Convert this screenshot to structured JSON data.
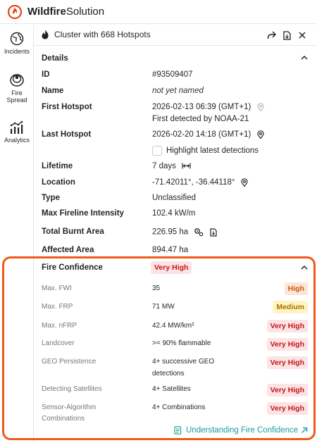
{
  "app": {
    "brand_bold": "Wildfire",
    "brand_light": "Solution"
  },
  "rail": {
    "incidents": "Incidents",
    "fire_spread_1": "Fire",
    "fire_spread_2": "Spread",
    "analytics": "Analytics"
  },
  "panel": {
    "title": "Cluster with 668 Hotspots"
  },
  "details": {
    "section_title": "Details",
    "rows": {
      "id": {
        "label": "ID",
        "value": "#93509407"
      },
      "name": {
        "label": "Name",
        "value": "not yet named"
      },
      "first_hotspot": {
        "label": "First Hotspot",
        "value": "2026-02-13 06:39 (GMT+1)",
        "sub": "First detected by NOAA-21"
      },
      "last_hotspot": {
        "label": "Last Hotspot",
        "value": "2026-02-20 14:18 (GMT+1)",
        "checkbox_label": "Highlight latest detections"
      },
      "lifetime": {
        "label": "Lifetime",
        "value": "7 days"
      },
      "location": {
        "label": "Location",
        "value": "-71.42011°, -36.44118°"
      },
      "type": {
        "label": "Type",
        "value": "Unclassified"
      },
      "max_fireline": {
        "label": "Max Fireline Intensity",
        "value": "102.4 kW/m"
      },
      "total_burnt": {
        "label": "Total Burnt Area",
        "value": "226.95 ha"
      },
      "affected": {
        "label": "Affected Area",
        "value": "894.47 ha"
      }
    }
  },
  "fire_confidence": {
    "title": "Fire Confidence",
    "overall": "Very High",
    "rows": [
      {
        "label": "Max. FWI",
        "value": "35",
        "badge": "High"
      },
      {
        "label": "Max. FRP",
        "value": "71 MW",
        "badge": "Medium"
      },
      {
        "label": "Max. nFRP",
        "value": "42.4 MW/km²",
        "badge": "Very High"
      },
      {
        "label": "Landcover",
        "value": ">= 90% flammable",
        "badge": "Very High"
      },
      {
        "label": "GEO Persistence",
        "value": "4+ successive GEO",
        "value2": "detections",
        "badge": "Very High"
      },
      {
        "label": "Detecting Satellites",
        "value": "4+ Satellites",
        "badge": "Very High"
      },
      {
        "label": "Sensor-Algorithm",
        "label2": "Combinations",
        "value": "4+ Combinations",
        "badge": "Very High"
      }
    ],
    "link": "Understanding Fire Confidence"
  },
  "colors": {
    "accent_orange": "#f05a1a",
    "link_teal": "#1a9aa0",
    "very_high_bg": "#fce4e4",
    "very_high_fg": "#c4161c",
    "high_bg": "#fde6d8",
    "high_fg": "#c95a10",
    "medium_bg": "#fff4c2",
    "medium_fg": "#a77400"
  }
}
